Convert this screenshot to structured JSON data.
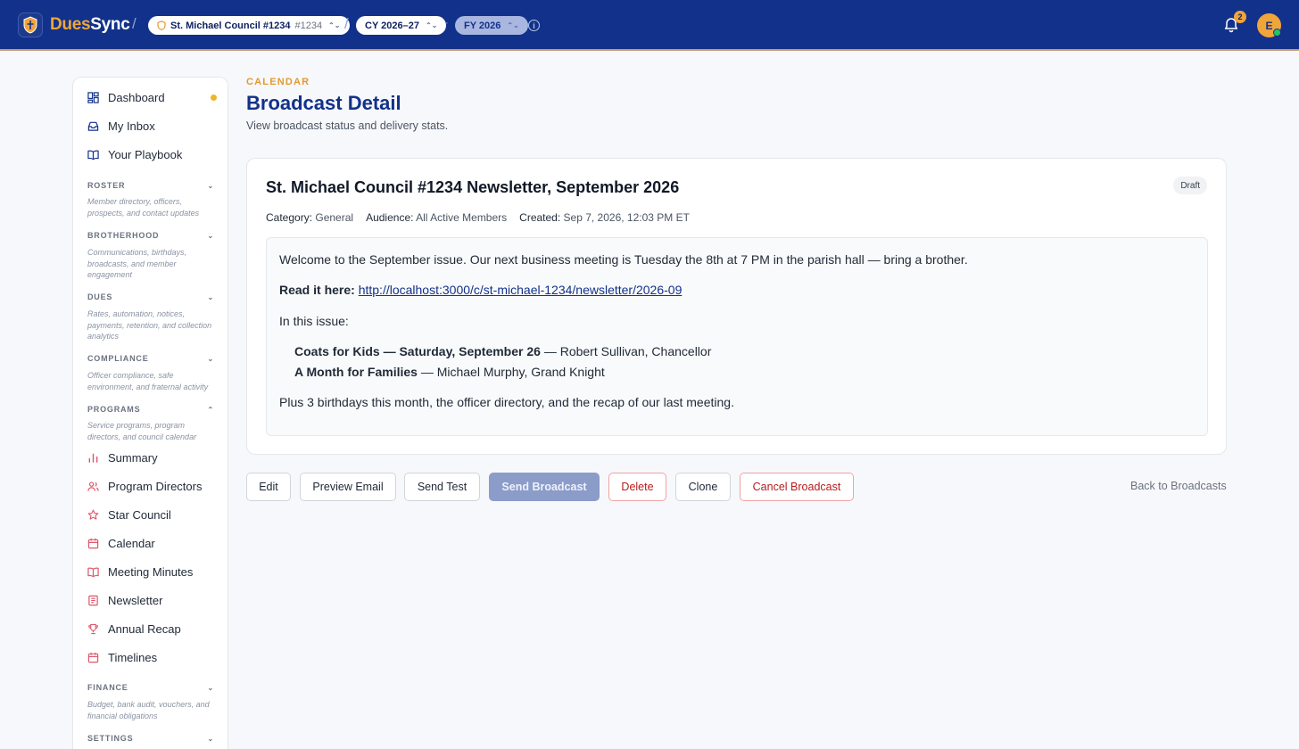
{
  "app": {
    "brand_part1": "Dues",
    "brand_part2": "Sync"
  },
  "topbar": {
    "council_name": "St. Michael Council #1234",
    "council_number": "#1234",
    "cy": "CY 2026–27",
    "fy": "FY 2026",
    "notification_count": "2",
    "avatar_initial": "E"
  },
  "sidebar": {
    "top_items": [
      {
        "label": "Dashboard",
        "icon": "dashboard-icon"
      },
      {
        "label": "My Inbox",
        "icon": "inbox-icon"
      },
      {
        "label": "Your Playbook",
        "icon": "book-icon"
      }
    ],
    "sections": [
      {
        "title": "ROSTER",
        "desc": "Member directory, officers, prospects, and contact updates"
      },
      {
        "title": "BROTHERHOOD",
        "desc": "Communications, birthdays, broadcasts, and member engagement"
      },
      {
        "title": "DUES",
        "desc": "Rates, automation, notices, payments, retention, and collection analytics"
      },
      {
        "title": "COMPLIANCE",
        "desc": "Officer compliance, safe environment, and fraternal activity"
      },
      {
        "title": "PROGRAMS",
        "desc": "Service programs, program directors, and council calendar"
      },
      {
        "title": "FINANCE",
        "desc": "Budget, bank audit, vouchers, and financial obligations"
      },
      {
        "title": "SETTINGS",
        "desc": ""
      }
    ],
    "program_items": [
      {
        "label": "Summary",
        "icon": "bar-chart-icon"
      },
      {
        "label": "Program Directors",
        "icon": "users-icon"
      },
      {
        "label": "Star Council",
        "icon": "star-icon"
      },
      {
        "label": "Calendar",
        "icon": "calendar-icon"
      },
      {
        "label": "Meeting Minutes",
        "icon": "book-open-icon"
      },
      {
        "label": "Newsletter",
        "icon": "newspaper-icon"
      },
      {
        "label": "Annual Recap",
        "icon": "trophy-icon"
      },
      {
        "label": "Timelines",
        "icon": "calendar-icon"
      }
    ]
  },
  "page": {
    "eyebrow": "CALENDAR",
    "title": "Broadcast Detail",
    "subtitle": "View broadcast status and delivery stats."
  },
  "broadcast": {
    "title": "St. Michael Council #1234 Newsletter, September 2026",
    "status": "Draft",
    "category_label": "Category:",
    "category": "General",
    "audience_label": "Audience:",
    "audience": "All Active Members",
    "created_label": "Created:",
    "created": "Sep 7, 2026, 12:03 PM ET",
    "intro": "Welcome to the September issue. Our next business meeting is Tuesday the 8th at 7 PM in the parish hall — bring a brother.",
    "read_label": "Read it here:",
    "read_url": "http://localhost:3000/c/st-michael-1234/newsletter/2026-09",
    "in_this_issue": "In this issue:",
    "items": [
      {
        "title": "Coats for Kids — Saturday, September 26",
        "author": " — Robert Sullivan, Chancellor"
      },
      {
        "title": "A Month for Families",
        "author": " — Michael Murphy, Grand Knight"
      }
    ],
    "outro": "Plus 3 birthdays this month, the officer directory, and the recap of our last meeting."
  },
  "actions": {
    "edit": "Edit",
    "preview": "Preview Email",
    "send_test": "Send Test",
    "send": "Send Broadcast",
    "delete": "Delete",
    "clone": "Clone",
    "cancel": "Cancel Broadcast",
    "back": "Back to Broadcasts"
  }
}
